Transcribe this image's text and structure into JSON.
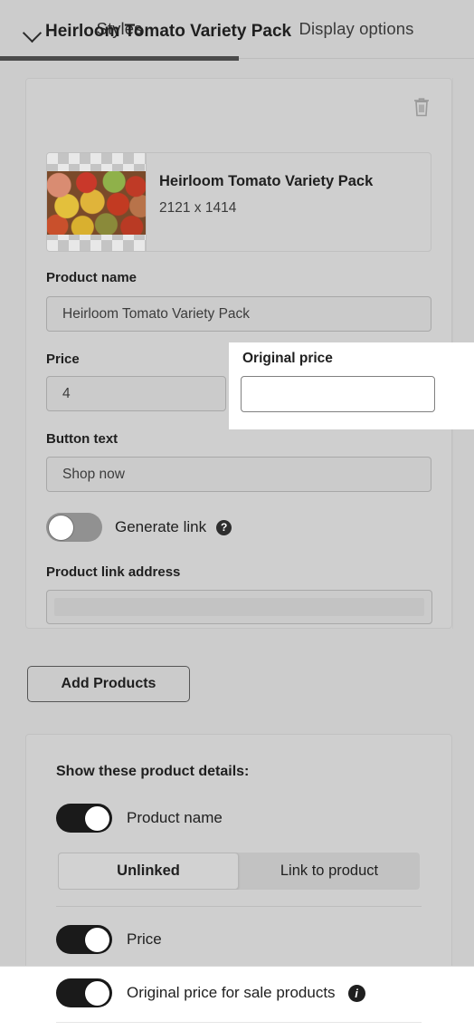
{
  "tabs": [
    {
      "label": "Styles",
      "active": true
    },
    {
      "label": "Display options",
      "active": false
    }
  ],
  "product_card": {
    "title": "Heirloom Tomato Variety Pack",
    "collapse_icon": "chevron-down-icon",
    "delete_icon": "trash-icon",
    "thumbnail": {
      "name": "Heirloom Tomato Variety Pack",
      "dimensions": "2121 x 1414"
    },
    "fields": {
      "product_name_label": "Product name",
      "product_name_value": "Heirloom Tomato Variety Pack",
      "price_label": "Price",
      "price_value": "4",
      "button_text_label": "Button text",
      "button_text_value": "Shop now",
      "link_address_label": "Product link address",
      "link_address_value": ""
    },
    "generate_link": {
      "label": "Generate link",
      "state": "off",
      "help_icon": "question-mark-icon"
    }
  },
  "overlay": {
    "label": "Original price",
    "value": "",
    "placeholder": ""
  },
  "add_products_label": "Add Products",
  "details_card": {
    "title": "Show these product details:",
    "rows": [
      {
        "label": "Product name",
        "state": "on",
        "info_icon": null
      },
      {
        "label": "Price",
        "state": "on",
        "info_icon": null
      },
      {
        "label": "Original price for sale products",
        "state": "on",
        "info_icon": "info-icon"
      }
    ],
    "link_mode": {
      "options": [
        {
          "label": "Unlinked",
          "selected": true
        },
        {
          "label": "Link to product",
          "selected": false
        }
      ]
    }
  },
  "colors": {
    "background": "#cccccc",
    "card": "#cfcfcf",
    "active_tab_underline": "#4a4a4a",
    "toggle_on": "#1a1a1a",
    "toggle_off": "#919191",
    "overlay_bg": "#ffffff"
  }
}
